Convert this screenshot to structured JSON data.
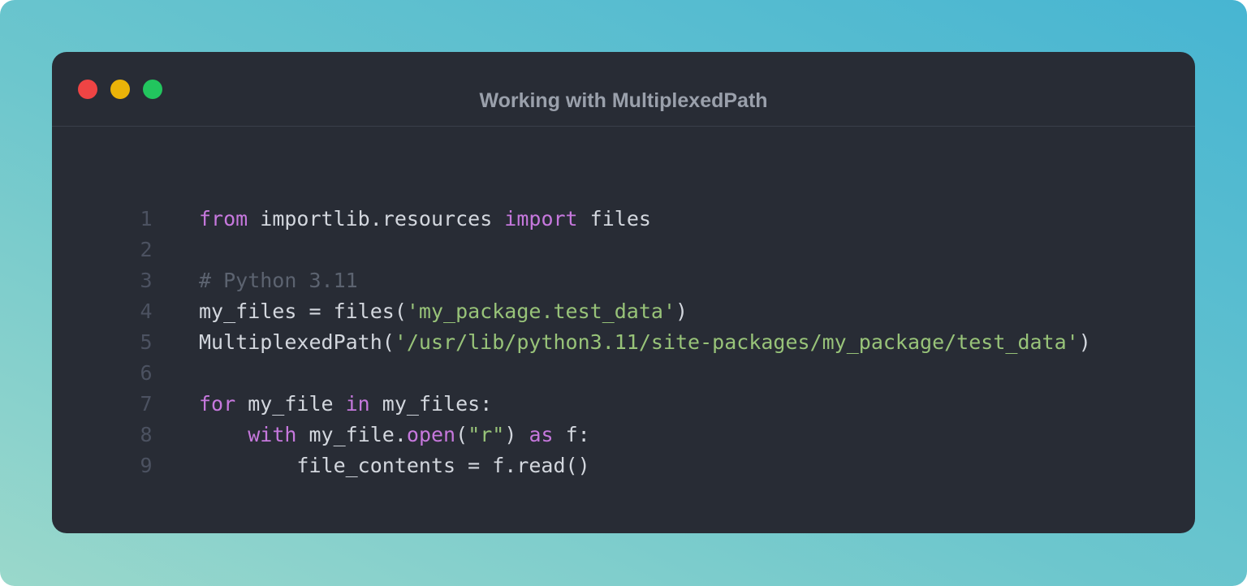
{
  "window": {
    "title": "Working with MultiplexedPath",
    "controls": {
      "close_color": "#ef4444",
      "minimize_color": "#eab308",
      "maximize_color": "#22c55e"
    }
  },
  "theme": {
    "background": "#282c35",
    "keyword": "#c678dd",
    "string": "#98c379",
    "comment": "#5c6370",
    "text": "#d3d7de",
    "line_number": "#4c5261"
  },
  "code": {
    "language": "python",
    "lines": [
      {
        "n": "1",
        "tokens": [
          {
            "t": "kw",
            "v": "from"
          },
          {
            "t": "p",
            "v": " importlib.resources "
          },
          {
            "t": "kw",
            "v": "import"
          },
          {
            "t": "p",
            "v": " files"
          }
        ]
      },
      {
        "n": "2",
        "tokens": []
      },
      {
        "n": "3",
        "tokens": [
          {
            "t": "cmt",
            "v": "# Python 3.11"
          }
        ]
      },
      {
        "n": "4",
        "tokens": [
          {
            "t": "p",
            "v": "my_files = files("
          },
          {
            "t": "str",
            "v": "'my_package.test_data'"
          },
          {
            "t": "p",
            "v": ")"
          }
        ]
      },
      {
        "n": "5",
        "tokens": [
          {
            "t": "p",
            "v": "MultiplexedPath("
          },
          {
            "t": "str",
            "v": "'/usr/lib/python3.11/site-packages/my_package/test_data'"
          },
          {
            "t": "p",
            "v": ")"
          }
        ]
      },
      {
        "n": "6",
        "tokens": []
      },
      {
        "n": "7",
        "tokens": [
          {
            "t": "kw",
            "v": "for"
          },
          {
            "t": "p",
            "v": " my_file "
          },
          {
            "t": "kw",
            "v": "in"
          },
          {
            "t": "p",
            "v": " my_files:"
          }
        ]
      },
      {
        "n": "8",
        "tokens": [
          {
            "t": "p",
            "v": "    "
          },
          {
            "t": "kw",
            "v": "with"
          },
          {
            "t": "p",
            "v": " my_file."
          },
          {
            "t": "fn",
            "v": "open"
          },
          {
            "t": "p",
            "v": "("
          },
          {
            "t": "str",
            "v": "\"r\""
          },
          {
            "t": "p",
            "v": ") "
          },
          {
            "t": "kw",
            "v": "as"
          },
          {
            "t": "p",
            "v": " f:"
          }
        ]
      },
      {
        "n": "9",
        "tokens": [
          {
            "t": "p",
            "v": "        file_contents = f.read()"
          }
        ]
      }
    ]
  }
}
